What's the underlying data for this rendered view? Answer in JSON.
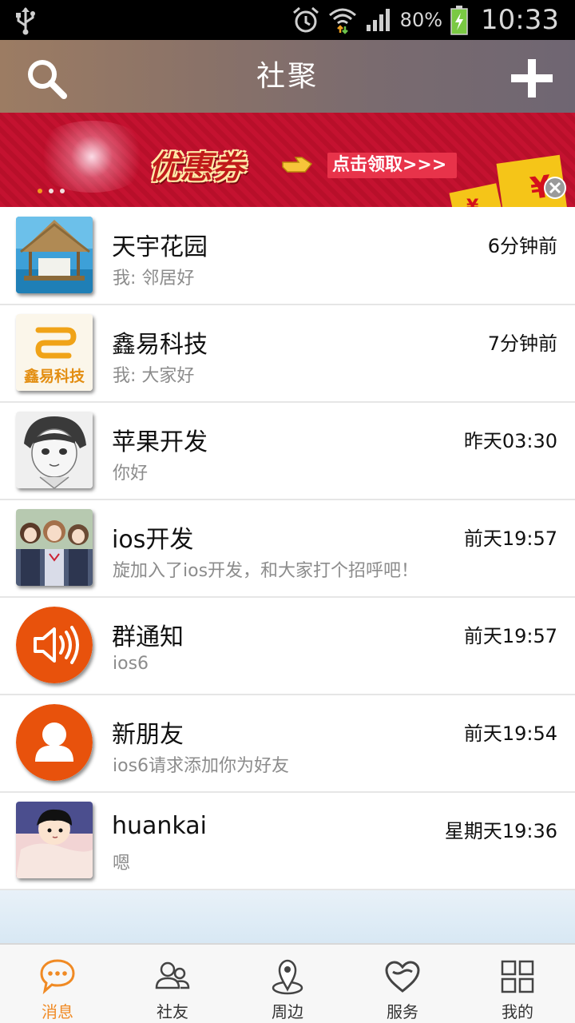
{
  "status_bar": {
    "battery": "80%",
    "time": "10:33"
  },
  "header": {
    "title": "社聚",
    "search_icon": "search-icon",
    "add_icon": "plus-icon"
  },
  "banner": {
    "coupon_text": "优惠券",
    "claim_text": "点击领取>>>",
    "dot_count": 3,
    "active_dot": 0
  },
  "conversations": [
    {
      "name": "天宇花园",
      "message": "我: 邻居好",
      "time": "6分钟前",
      "avatar": "hut-photo"
    },
    {
      "name": "鑫易科技",
      "message": "我: 大家好",
      "time": "7分钟前",
      "avatar": "xinyi-logo"
    },
    {
      "name": "苹果开发",
      "message": "你好",
      "time": "昨天03:30",
      "avatar": "sketch-boy"
    },
    {
      "name": "ios开发",
      "message": "旋加入了ios开发，和大家打个招呼吧！",
      "time": "前天19:57",
      "avatar": "anime-girls"
    },
    {
      "name": "群通知",
      "message": "ios6",
      "time": "前天19:57",
      "avatar": "speaker-icon"
    },
    {
      "name": "新朋友",
      "message": "ios6请求添加你为好友",
      "time": "前天19:54",
      "avatar": "person-icon"
    },
    {
      "name": "huankai",
      "message": "嗯",
      "time": "星期天19:36",
      "avatar": "cartoon-kid"
    }
  ],
  "bottom_nav": [
    {
      "label": "消息",
      "icon": "chat-bubble-icon",
      "active": true
    },
    {
      "label": "社友",
      "icon": "friends-icon",
      "active": false
    },
    {
      "label": "周边",
      "icon": "location-pin-icon",
      "active": false
    },
    {
      "label": "服务",
      "icon": "heart-hands-icon",
      "active": false
    },
    {
      "label": "我的",
      "icon": "grid-icon",
      "active": false
    }
  ],
  "colors": {
    "accent": "#f08a24",
    "header_start": "#9c7c63",
    "header_end": "#6f6672",
    "banner_red": "#c41230",
    "orange_avatar": "#e8520c"
  }
}
